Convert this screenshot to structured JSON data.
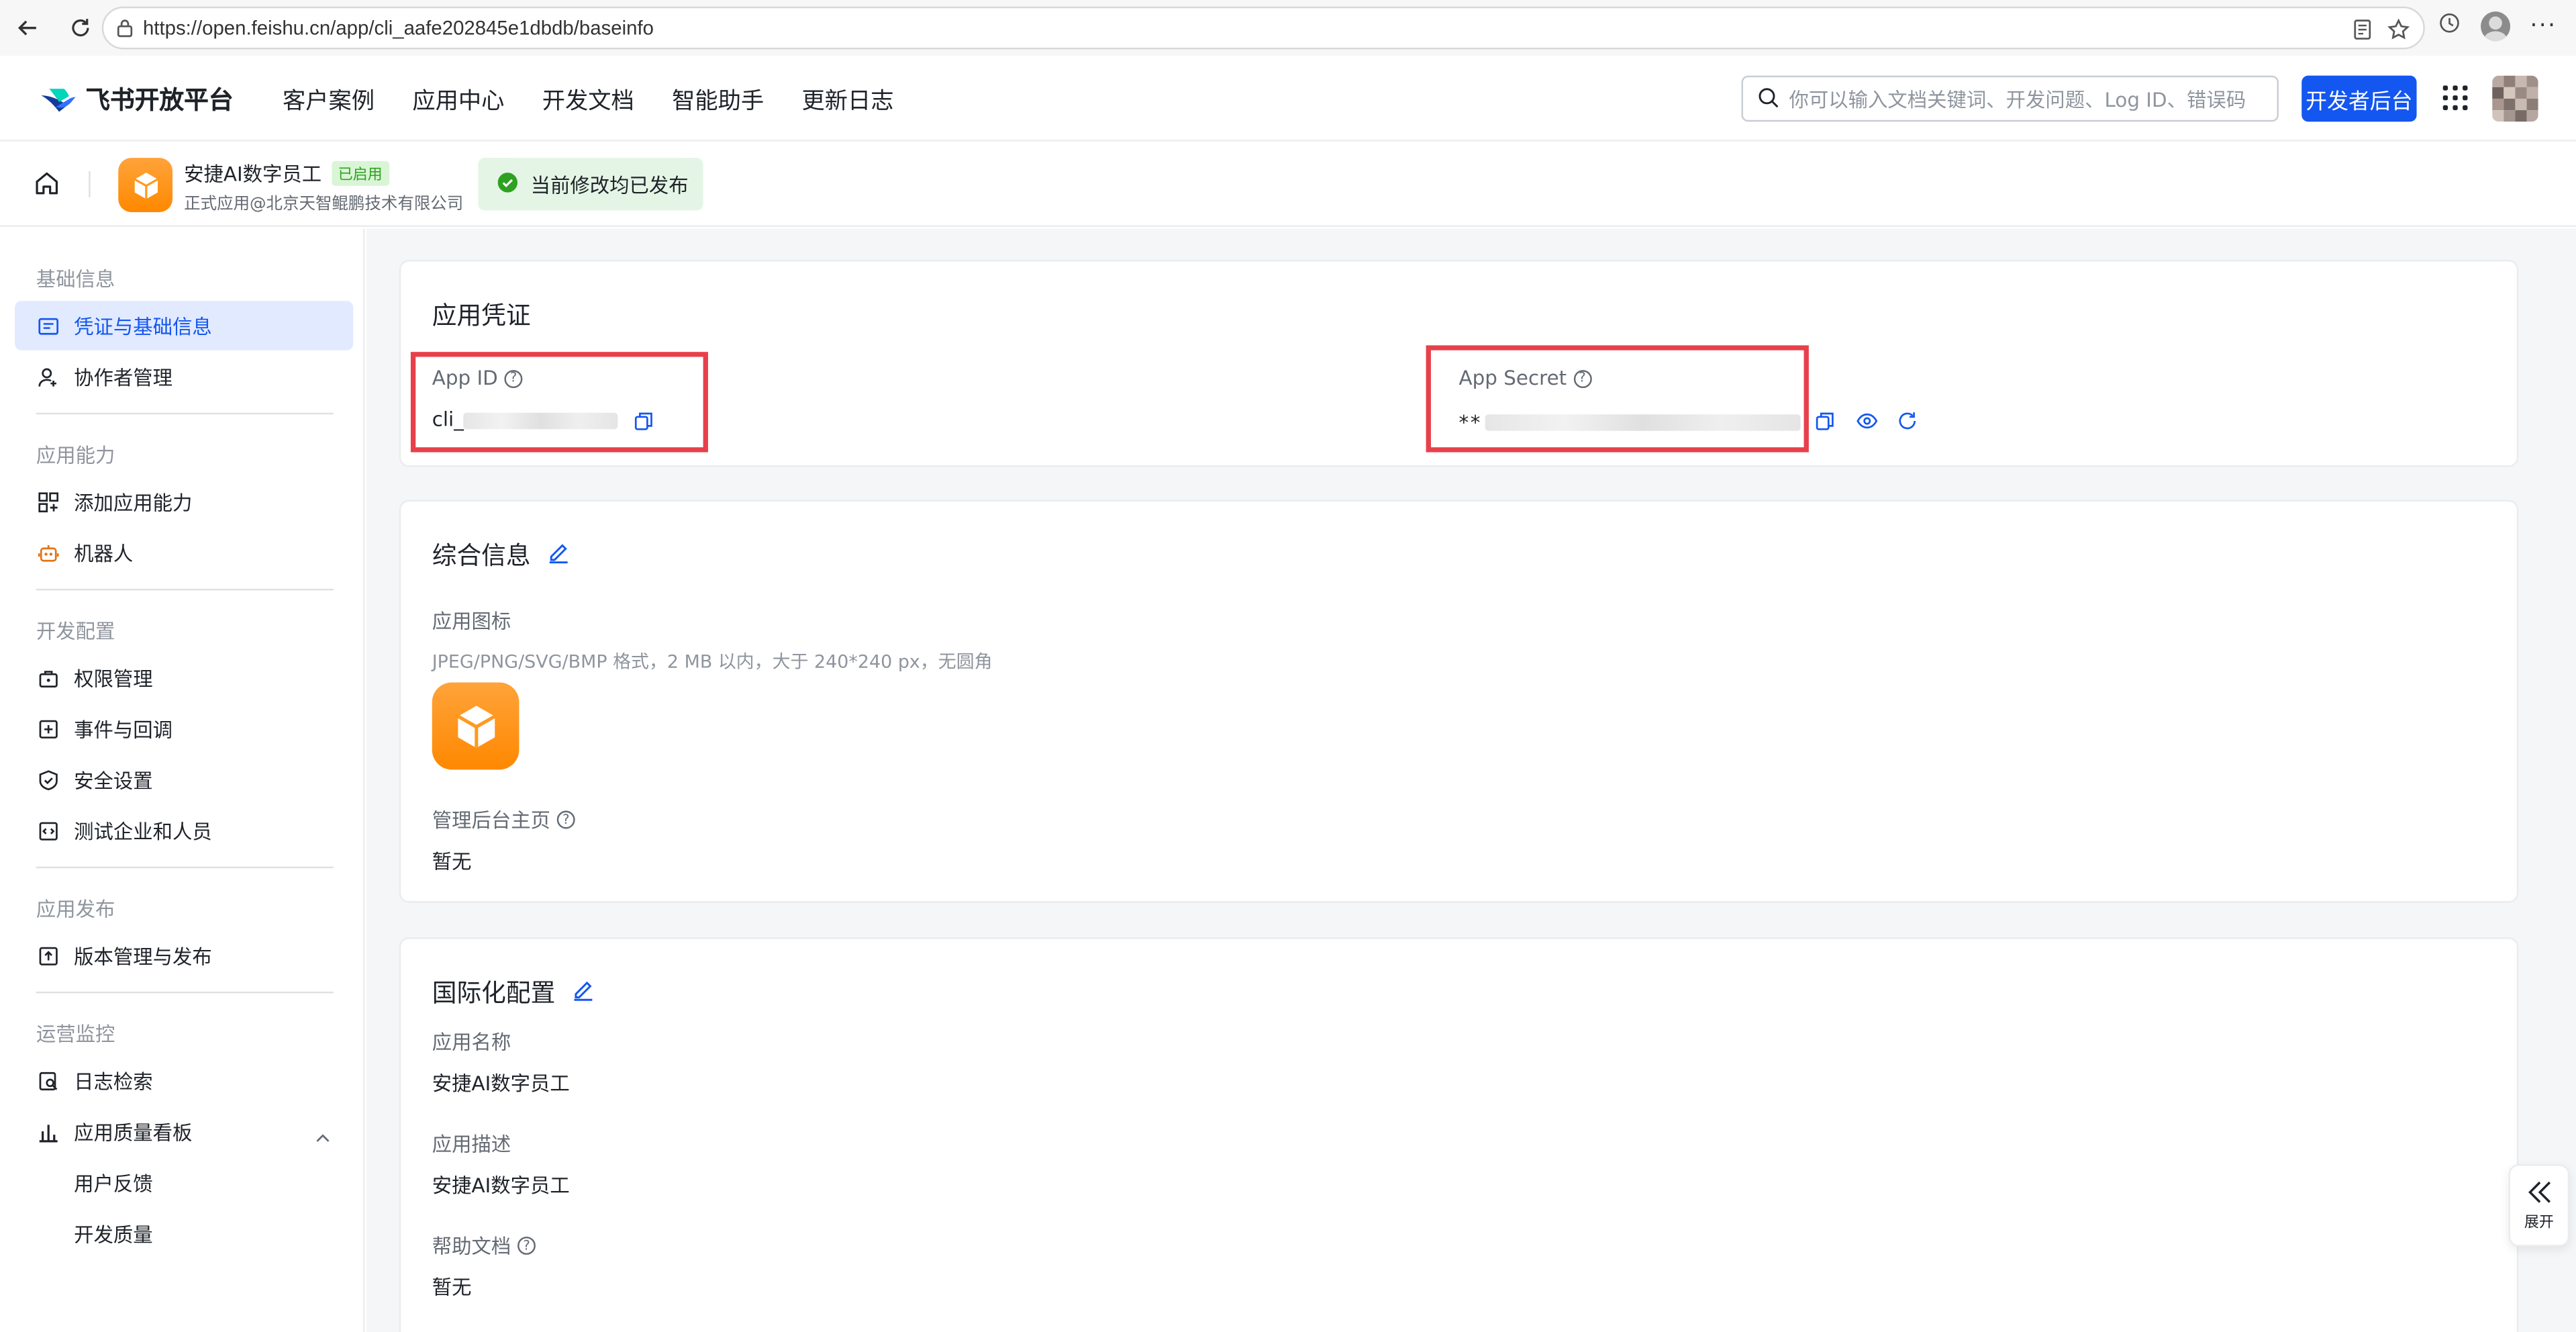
{
  "browser": {
    "url": "https://open.feishu.cn/app/cli_aafe202845e1dbdb/baseinfo"
  },
  "topnav": {
    "logo_text": "飞书开放平台",
    "links": [
      "客户案例",
      "应用中心",
      "开发文档",
      "智能助手",
      "更新日志"
    ],
    "search_placeholder": "你可以输入文档关键词、开发问题、Log ID、错误码",
    "dev_console_label": "开发者后台"
  },
  "app_header": {
    "app_name": "安捷AI数字员工",
    "status_badge": "已启用",
    "org": "正式应用@北京天智鲲鹏技术有限公司",
    "publish_status": "当前修改均已发布"
  },
  "sidebar": {
    "groups": [
      {
        "title": "基础信息",
        "items": [
          "凭证与基础信息",
          "协作者管理"
        ]
      },
      {
        "title": "应用能力",
        "items": [
          "添加应用能力",
          "机器人"
        ]
      },
      {
        "title": "开发配置",
        "items": [
          "权限管理",
          "事件与回调",
          "安全设置",
          "测试企业和人员"
        ]
      },
      {
        "title": "应用发布",
        "items": [
          "版本管理与发布"
        ]
      },
      {
        "title": "运营监控",
        "items": [
          "日志检索",
          "应用质量看板",
          "用户反馈",
          "开发质量"
        ]
      }
    ],
    "active_item": "凭证与基础信息"
  },
  "credentials": {
    "title": "应用凭证",
    "app_id_label": "App ID",
    "app_id_value": "cli_",
    "app_secret_label": "App Secret",
    "app_secret_value": "**"
  },
  "general_info": {
    "title": "综合信息",
    "icon_label": "应用图标",
    "icon_hint": "JPEG/PNG/SVG/BMP 格式，2 MB 以内，大于 240*240 px，无圆角",
    "admin_home_label": "管理后台主页",
    "admin_home_value": "暂无"
  },
  "i18n": {
    "title": "国际化配置",
    "name_label": "应用名称",
    "name_value": "安捷AI数字员工",
    "desc_label": "应用描述",
    "desc_value": "安捷AI数字员工",
    "help_label": "帮助文档",
    "help_value": "暂无"
  },
  "expand_panel": {
    "label": "展开"
  },
  "colors": {
    "brand_blue": "#1456f0",
    "active_bg": "#e1eaff",
    "app_orange": "#ff8800",
    "highlight_red": "#e8404a",
    "success_green": "#2ea121"
  }
}
